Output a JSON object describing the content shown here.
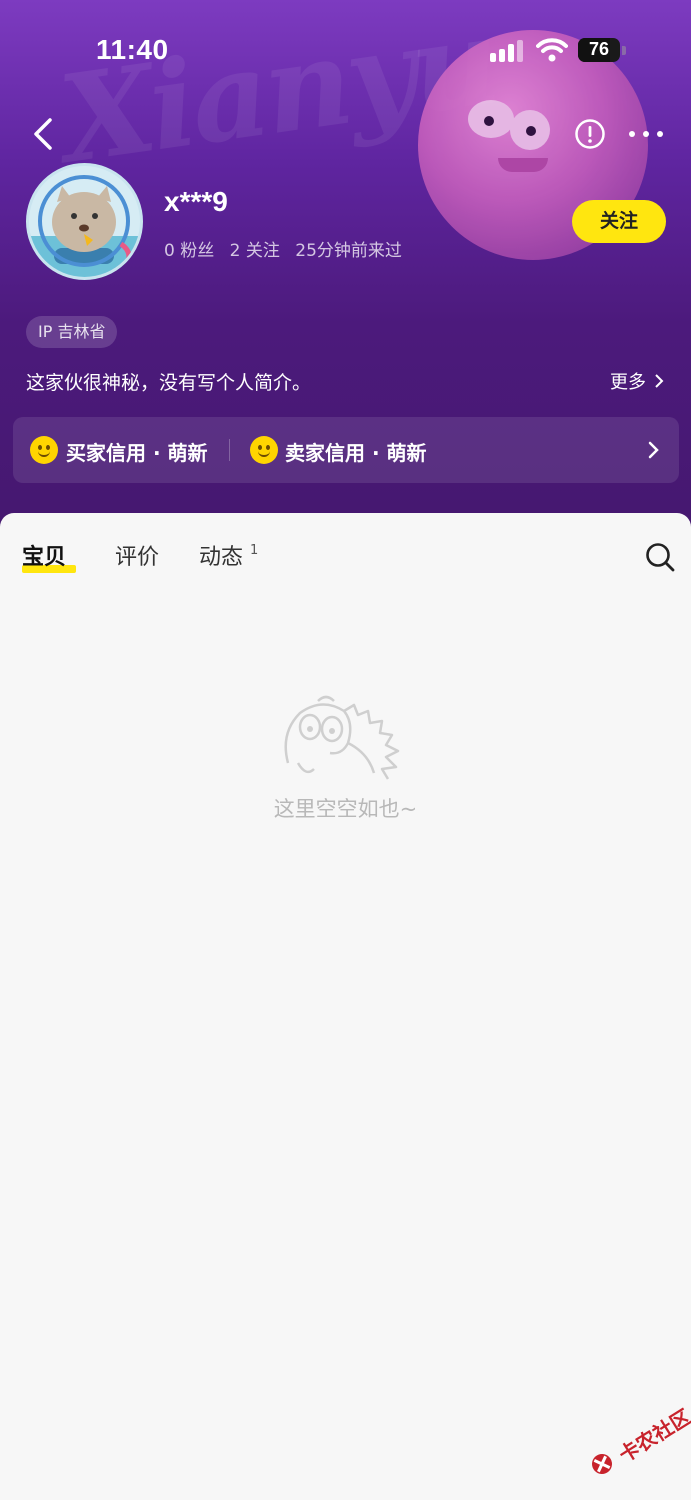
{
  "status_bar": {
    "time": "11:40",
    "battery": "76"
  },
  "header": {
    "background_text": "Xianyu",
    "username": "x***9",
    "stats": [
      "0 粉丝",
      "2 关注",
      "25分钟前来过"
    ],
    "follow_label": "关注",
    "ip_tag": "IP 吉林省",
    "bio": "这家伙很神秘，没有写个人简介。",
    "more_label": "更多",
    "credit": {
      "buyer": "买家信用 · 萌新",
      "seller": "卖家信用 · 萌新"
    },
    "colors": {
      "accent": "#ffe60f",
      "header_top": "#7d3bc0",
      "header_bottom": "#45186f"
    }
  },
  "tabs": [
    {
      "label": "宝贝",
      "active": true
    },
    {
      "label": "评价",
      "active": false
    },
    {
      "label": "动态",
      "active": false,
      "badge": "1"
    }
  ],
  "empty_state": {
    "text": "这里空空如也~"
  },
  "icons": [
    "back-icon",
    "report-icon",
    "more-icon",
    "search-icon",
    "chevron-right-icon"
  ],
  "watermark": {
    "text": "卡农社区"
  }
}
